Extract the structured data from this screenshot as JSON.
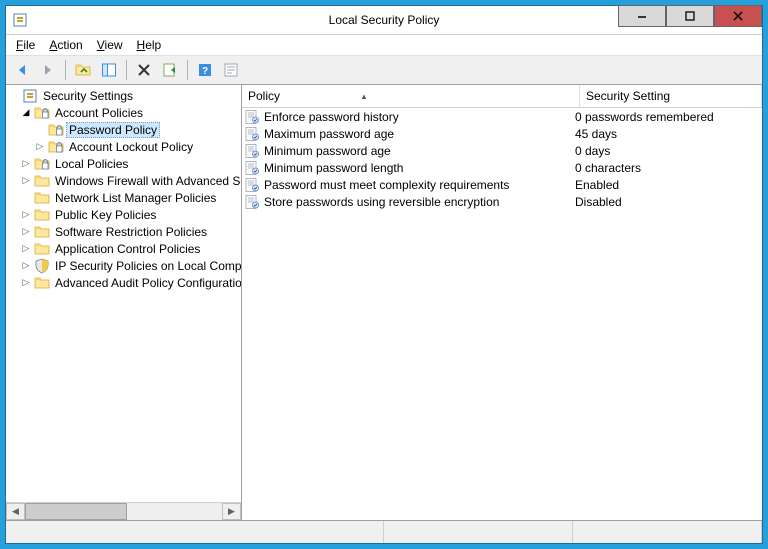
{
  "window": {
    "title": "Local Security Policy"
  },
  "menu": {
    "file": "File",
    "action": "Action",
    "view": "View",
    "help": "Help"
  },
  "tree": {
    "root": "Security Settings",
    "account_policies": "Account Policies",
    "password_policy": "Password Policy",
    "account_lockout_policy": "Account Lockout Policy",
    "local_policies": "Local Policies",
    "windows_firewall": "Windows Firewall with Advanced Security",
    "network_list_manager": "Network List Manager Policies",
    "public_key_policies": "Public Key Policies",
    "software_restriction": "Software Restriction Policies",
    "application_control": "Application Control Policies",
    "ip_security": "IP Security Policies on Local Computer",
    "advanced_audit": "Advanced Audit Policy Configuration"
  },
  "columns": {
    "policy": "Policy",
    "setting": "Security Setting"
  },
  "policies": [
    {
      "name": "Enforce password history",
      "value": "0 passwords remembered"
    },
    {
      "name": "Maximum password age",
      "value": "45 days"
    },
    {
      "name": "Minimum password age",
      "value": "0 days"
    },
    {
      "name": "Minimum password length",
      "value": "0 characters"
    },
    {
      "name": "Password must meet complexity requirements",
      "value": "Enabled"
    },
    {
      "name": "Store passwords using reversible encryption",
      "value": "Disabled"
    }
  ]
}
